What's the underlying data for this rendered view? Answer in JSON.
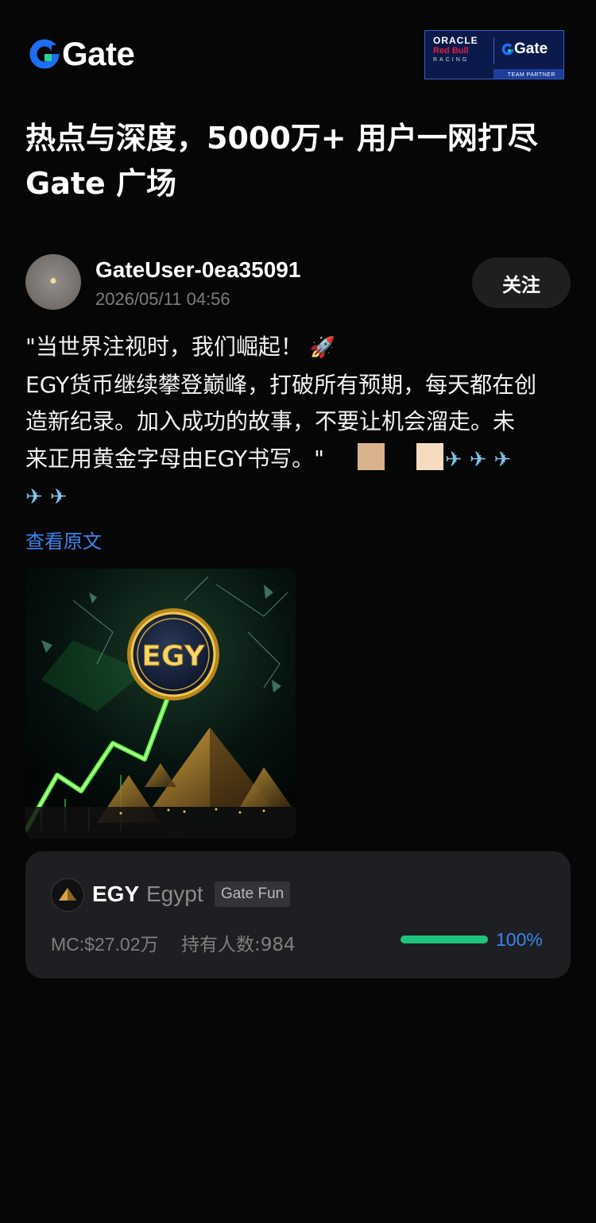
{
  "header": {
    "logo_text": "Gate",
    "partner": {
      "oracle": "ORACLE",
      "redbull": "Red Bull",
      "racing": "RACING",
      "brand": "Gate",
      "team_partner": "TEAM PARTNER"
    }
  },
  "headline": {
    "line1": "热点与深度，5000万+ 用户一网打尽",
    "line2": "Gate 广场"
  },
  "author": {
    "name": "GateUser-0ea35091",
    "time": "2026/05/11 04:56",
    "follow_label": "关注"
  },
  "post": {
    "line1": "\"当世界注视时，我们崛起！ ",
    "line2": "EGY货币继续攀登巅峰，打破所有预期，每天都在创",
    "line3": "造新纪录。加入成功的故事，不要让机会溜走。未",
    "line4": "来正用黄金字母由EGY书写。\"",
    "plane": "✈",
    "rocket": "🚀",
    "view_original": "查看原文"
  },
  "image": {
    "coin_text": "EGY"
  },
  "token": {
    "symbol": "EGY",
    "name": "Egypt",
    "badge": "Gate Fun",
    "market_cap": "MC:$27.02万",
    "holders": "持有人数:984",
    "progress_percent": 100,
    "progress_label": "100%"
  },
  "colors": {
    "background": "#060606",
    "accent_blue": "#3a84f0",
    "progress_green": "#1ec47e",
    "card_bg": "#1e1f22",
    "brand_blue": "#1e6ef4",
    "brand_green": "#2ad18f",
    "swatch1": "#d9b38c",
    "swatch2": "#f5dcc0"
  },
  "icons": {
    "logo": "gate-logo-icon",
    "rocket": "rocket-icon",
    "plane": "airplane-icon"
  }
}
